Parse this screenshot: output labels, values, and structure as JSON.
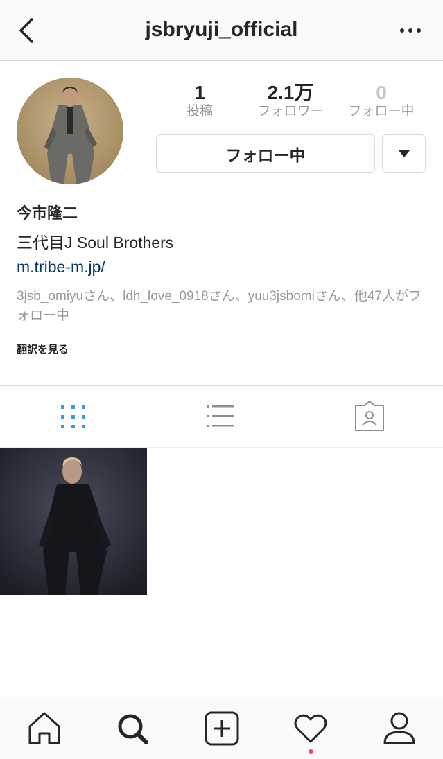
{
  "header": {
    "username": "jsbryuji_official",
    "back_icon": "chevron-left-icon",
    "more_icon": "more-horizontal-icon"
  },
  "profile": {
    "stats": {
      "posts": {
        "count": "1",
        "label": "投稿"
      },
      "followers": {
        "count": "2.1万",
        "label": "フォロワー"
      },
      "following": {
        "count": "0",
        "label": "フォロー中"
      }
    },
    "follow_button_label": "フォロー中",
    "dropdown_icon": "caret-down-icon"
  },
  "bio": {
    "name": "今市隆二",
    "description": "三代目J Soul Brothers",
    "link": "m.tribe-m.jp/",
    "followed_by": "3jsb_omiyuさん、ldh_love_0918さん、yuu3jsbomiさん、他47人がフォロー中",
    "translate_label": "翻訳を見る"
  },
  "tabs": {
    "active": "grid",
    "items": [
      "grid-icon",
      "list-icon",
      "tagged-icon"
    ]
  },
  "bottom_nav": {
    "items": [
      "home-icon",
      "search-icon",
      "add-post-icon",
      "heart-icon",
      "profile-icon"
    ],
    "has_activity_notification": true
  },
  "colors": {
    "active_tab": "#3897f0",
    "link": "#003569",
    "muted_text": "#999999",
    "notification": "#ed4956",
    "border": "#dbdbdb"
  }
}
